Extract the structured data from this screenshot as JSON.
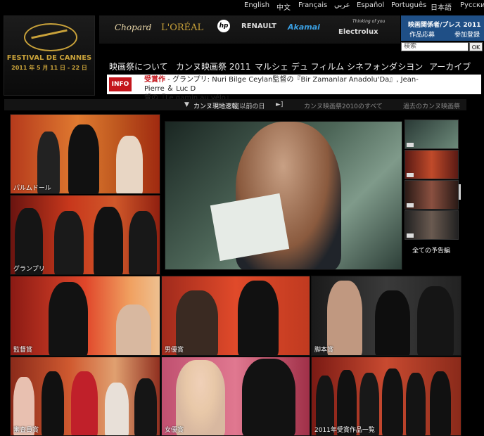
{
  "languages": [
    "English",
    "中文",
    "Français",
    "عربي",
    "Español",
    "Português",
    "日本語",
    "Русский"
  ],
  "logo": {
    "title": "FESTIVAL DE CANNES",
    "dates": "2011 年 5 月 11 日 - 22 日"
  },
  "sponsors": [
    "Chopard",
    "L'ORÉAL",
    "hp",
    "RENAULT",
    "Akamai",
    "Electrolux"
  ],
  "sponsor_tagline": "Thinking of you",
  "press": {
    "line1": "映画関係者/プレス 2011",
    "link1": "作品応募",
    "link2": "参加登録"
  },
  "search": {
    "placeholder": "検索",
    "button": "OK"
  },
  "nav": [
    "映画祭について",
    "カンヌ映画祭 2011",
    "マルシェ デュ フィルム",
    "シネフォンダシヨン",
    "アーカイブ"
  ],
  "info": {
    "label": "INFO",
    "bold": "受賞作",
    "text1": " - グランプリ: Nuri Bilge Ceylan監督の『Bir Zamanlar Anadolu'Da』, Jean-Pierre ＆ Luc D",
    "text2": "督の『Le gamin au vélo』"
  },
  "subbar": {
    "live": "カンヌ現地速報",
    "prev": "[以前の日",
    "arrow": "►]",
    "all2010": "カンヌ映画祭2010のすべて",
    "past": "過去のカンヌ映画祭"
  },
  "tiles": {
    "palme": "パルムドール",
    "grand": "グランプリ",
    "director": "監督賞",
    "actor": "男優賞",
    "screenplay": "脚本賞",
    "jury": "審査員賞",
    "actress": "女優賞",
    "winners": "2011年受賞作品一覧"
  },
  "trailers_label": "全ての予告編",
  "colors": {
    "accent_red": "#c4161c",
    "gold": "#c9a23a",
    "press_blue": "#1f4f86"
  }
}
